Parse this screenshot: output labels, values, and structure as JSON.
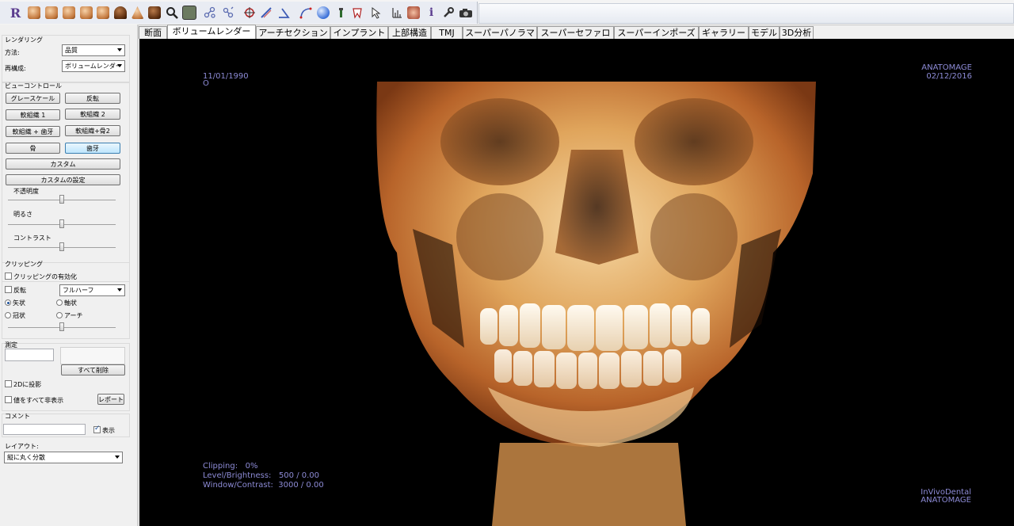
{
  "toolbar": {
    "logo_letter": "R",
    "info_letter": "i",
    "icons": [
      "render-icon",
      "face-left-icon",
      "face-three-quarter-icon",
      "face-front-icon",
      "face-right-icon",
      "skull-bottom-icon",
      "face-profile-icon",
      "skull-front-icon",
      "search-icon",
      "image-icon",
      "molecule-icon",
      "molecule-2-icon",
      "target-icon",
      "ruler-icon",
      "angle-icon",
      "curve-icon",
      "sphere-icon",
      "pin-icon",
      "tooth-icon",
      "cursor-icon",
      "measure-icon",
      "tooth-3d-icon",
      "info-icon",
      "wrench-icon",
      "camera-icon"
    ]
  },
  "tabs": [
    "断面",
    "ボリュームレンダー",
    "アーチセクション",
    "インプラント",
    "上部構造",
    "TMJ",
    "スーパーパノラマ",
    "スーパーセファロ",
    "スーパーインポーズ",
    "ギャラリー",
    "モデル",
    "3D分析"
  ],
  "active_tab": "ボリュームレンダー",
  "panel": {
    "rendering": {
      "title": "レンダリング",
      "method_label": "方法:",
      "method_value": "品質",
      "reconstruct_label": "再構成:",
      "reconstruct_value": "ボリュームレンダー"
    },
    "view_control": {
      "title": "ビューコントロール",
      "grayscale": "グレースケール",
      "invert": "反転",
      "soft_tissue1": "軟組織 1",
      "soft_tissue2": "軟組織 2",
      "soft_teeth": "軟組織 + 歯牙",
      "soft_bone2": "軟組織+骨2",
      "bone": "骨",
      "teeth": "歯牙",
      "custom": "カスタム",
      "custom_settings": "カスタムの設定",
      "opacity_label": "不透明度",
      "brightness_label": "明るさ",
      "contrast_label": "コントラスト",
      "opacity_value": 0.5,
      "brightness_value": 0.5,
      "contrast_value": 0.5
    },
    "clipping": {
      "title": "クリッピング",
      "enable_label": "クリッピングの有効化",
      "invert_label": "反転",
      "mode_value": "フルハーフ",
      "sagittal": "矢状",
      "axial": "軸状",
      "coronal": "冠状",
      "arch": "アーチ",
      "clip_value": 0.5
    },
    "measure": {
      "title": "測定",
      "delete_all": "すべて削除",
      "project_2d": "2Dに投影",
      "hide_values": "値をすべて非表示",
      "report": "レポート"
    },
    "comment": {
      "title": "コメント",
      "show_label": "表示",
      "show_checked": true
    },
    "layout": {
      "title": "レイアウト:",
      "value": "縦に丸く分散"
    }
  },
  "viewport": {
    "date_left": "11/01/1990",
    "circle_marker": "O",
    "brand_top": "ANATOMAGE",
    "date_right": "02/12/2016",
    "clipping_line": "Clipping:   0%",
    "level_line": "Level/Brightness:   500 / 0.00",
    "window_line": "Window/Contrast:  3000 / 0.00",
    "brand_bottom_1": "InVivoDental",
    "brand_bottom_2": "ANATOMAGE",
    "overlay_color": "#8d8bd6"
  }
}
